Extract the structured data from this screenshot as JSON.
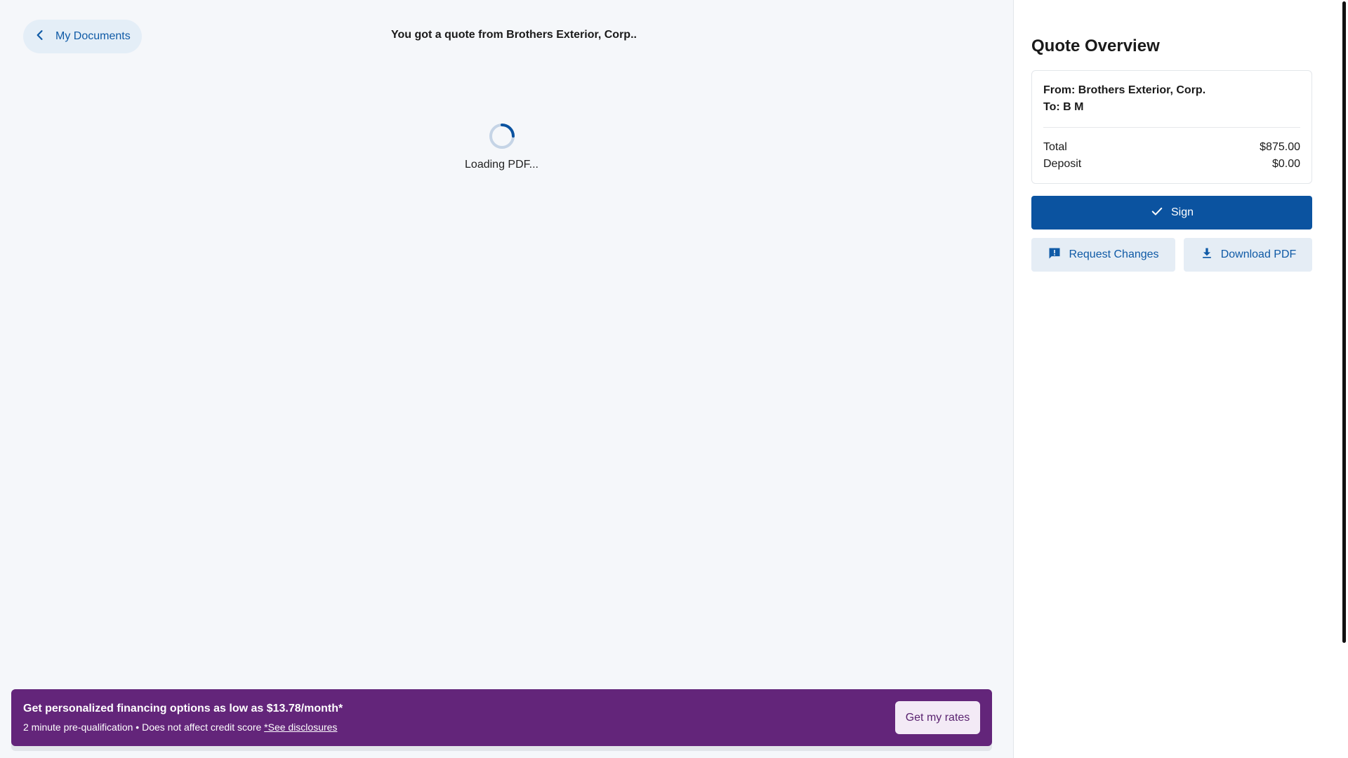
{
  "nav": {
    "back_label": "My Documents"
  },
  "main": {
    "title": "You got a quote from Brothers Exterior, Corp..",
    "loading_text": "Loading PDF..."
  },
  "banner": {
    "headline": "Get personalized financing options as low as $13.78/month*",
    "subtext": "2 minute pre-qualification • Does not affect credit score ",
    "disclosure_link": "*See disclosures",
    "cta_label": "Get my rates"
  },
  "overview": {
    "title": "Quote Overview",
    "from": "From: Brothers Exterior, Corp.",
    "to": "To: B M",
    "rows": [
      {
        "label": "Total",
        "value": "$875.00"
      },
      {
        "label": "Deposit",
        "value": "$0.00"
      }
    ]
  },
  "actions": {
    "sign_label": "Sign",
    "request_changes_label": "Request Changes",
    "download_label": "Download PDF"
  },
  "icons": {
    "back": "chevron-left-icon",
    "sign": "check-icon",
    "request_changes": "feedback-icon",
    "download": "download-icon",
    "spinner": "spinner-icon"
  },
  "colors": {
    "primary": "#0b53a0",
    "primary_text": "#0f5aa6",
    "secondary_bg": "#e5edf5",
    "banner_bg": "#63257a",
    "main_bg": "#f5f7fa"
  }
}
